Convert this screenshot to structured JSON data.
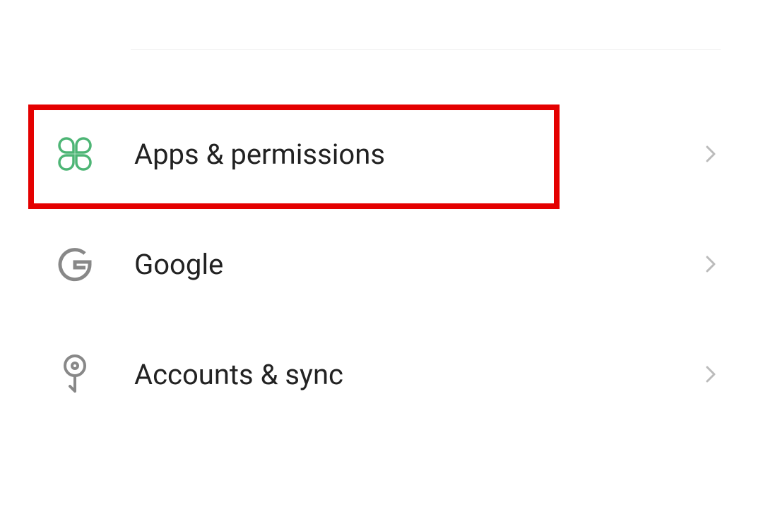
{
  "settings": {
    "items": [
      {
        "label": "Apps & permissions",
        "icon": "apps-icon",
        "highlighted": true
      },
      {
        "label": "Google",
        "icon": "google-icon",
        "highlighted": false
      },
      {
        "label": "Accounts & sync",
        "icon": "key-icon",
        "highlighted": false
      }
    ]
  },
  "colors": {
    "highlight": "#e40000",
    "apps_icon": "#4db575",
    "icon_gray": "#888888",
    "chevron": "#bbbbbb",
    "text": "#222222"
  }
}
